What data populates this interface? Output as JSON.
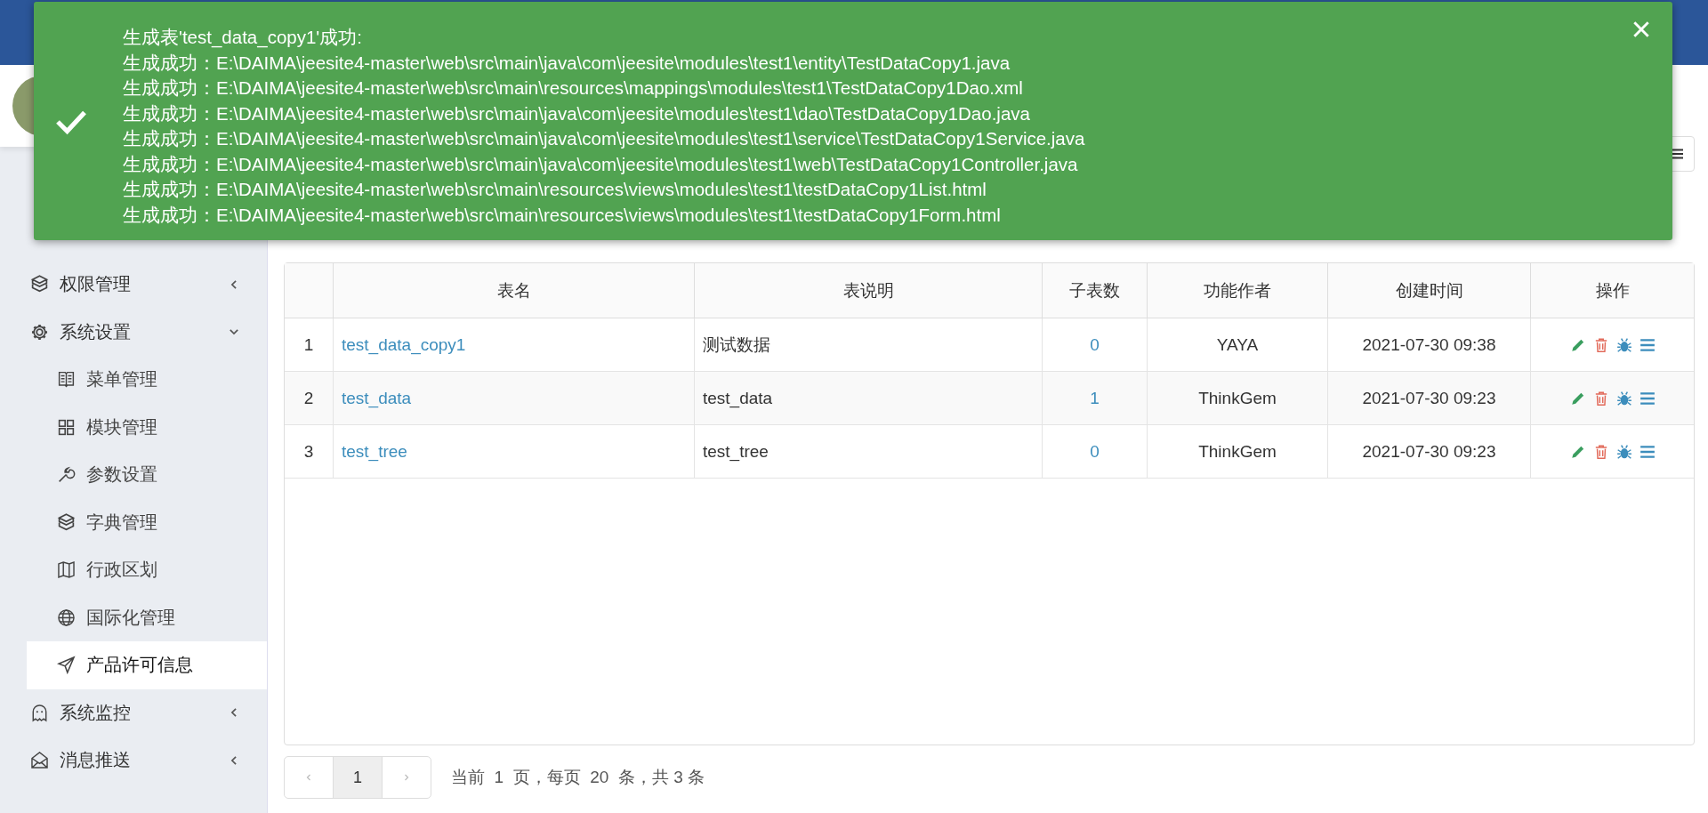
{
  "toast": {
    "title": "生成表'test_data_copy1'成功:",
    "lines": [
      "生成成功：E:\\DAIMA\\jeesite4-master\\web\\src\\main\\java\\com\\jeesite\\modules\\test1\\entity\\TestDataCopy1.java",
      "生成成功：E:\\DAIMA\\jeesite4-master\\web\\src\\main\\resources\\mappings\\modules\\test1\\TestDataCopy1Dao.xml",
      "生成成功：E:\\DAIMA\\jeesite4-master\\web\\src\\main\\java\\com\\jeesite\\modules\\test1\\dao\\TestDataCopy1Dao.java",
      "生成成功：E:\\DAIMA\\jeesite4-master\\web\\src\\main\\java\\com\\jeesite\\modules\\test1\\service\\TestDataCopy1Service.java",
      "生成成功：E:\\DAIMA\\jeesite4-master\\web\\src\\main\\java\\com\\jeesite\\modules\\test1\\web\\TestDataCopy1Controller.java",
      "生成成功：E:\\DAIMA\\jeesite4-master\\web\\src\\main\\resources\\views\\modules\\test1\\testDataCopy1List.html",
      "生成成功：E:\\DAIMA\\jeesite4-master\\web\\src\\main\\resources\\views\\modules\\test1\\testDataCopy1Form.html"
    ]
  },
  "sidebar": {
    "items": [
      {
        "label": "权限管理",
        "expanded": false
      },
      {
        "label": "系统设置",
        "expanded": true,
        "children": [
          {
            "label": "菜单管理",
            "selected": false
          },
          {
            "label": "模块管理",
            "selected": false
          },
          {
            "label": "参数设置",
            "selected": false
          },
          {
            "label": "字典管理",
            "selected": false
          },
          {
            "label": "行政区划",
            "selected": false
          },
          {
            "label": "国际化管理",
            "selected": false
          },
          {
            "label": "产品许可信息",
            "selected": true
          }
        ]
      },
      {
        "label": "系统监控",
        "expanded": false
      },
      {
        "label": "消息推送",
        "expanded": false
      }
    ]
  },
  "table": {
    "columns": [
      "表名",
      "表说明",
      "子表数",
      "功能作者",
      "创建时间",
      "操作"
    ],
    "rows": [
      {
        "index": "1",
        "name": "test_data_copy1",
        "comment": "测试数据",
        "sub_tables": "0",
        "author": "YAYA",
        "created": "2021-07-30 09:38"
      },
      {
        "index": "2",
        "name": "test_data",
        "comment": "test_data",
        "sub_tables": "1",
        "author": "ThinkGem",
        "created": "2021-07-30 09:23"
      },
      {
        "index": "3",
        "name": "test_tree",
        "comment": "test_tree",
        "sub_tables": "0",
        "author": "ThinkGem",
        "created": "2021-07-30 09:23"
      }
    ]
  },
  "pagination": {
    "pages": [
      {
        "label": "1",
        "selected": true
      }
    ],
    "summary": "当前  1  页，每页  20  条，共 3 条"
  }
}
